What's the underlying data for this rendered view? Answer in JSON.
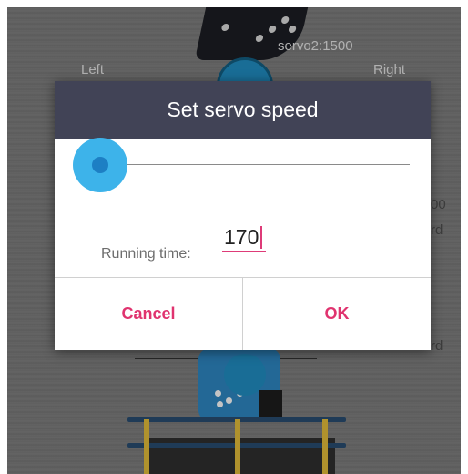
{
  "background": {
    "servo_label": "servo2:1500",
    "left_label": "Left",
    "right_label": "Right",
    "partial_value": "00",
    "partial_rd_1": "rd",
    "partial_rd_2": "rd"
  },
  "dialog": {
    "title": "Set servo speed",
    "slider_value_fraction": 0.0,
    "running_time_label": "Running time:",
    "running_time_value": "170",
    "cancel_label": "Cancel",
    "ok_label": "OK"
  },
  "colors": {
    "header": "#414356",
    "accent": "#e0336f",
    "slider": "#3db3ea"
  }
}
